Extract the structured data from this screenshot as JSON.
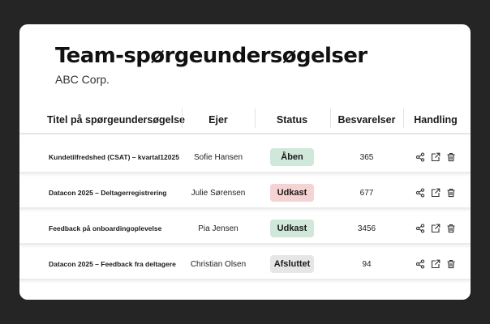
{
  "header": {
    "title": "Team-spørgeundersøgelser",
    "subtitle": "ABC Corp."
  },
  "table": {
    "columns": [
      "Titel på spørgeundersøgelse",
      "Ejer",
      "Status",
      "Besvarelser",
      "Handling"
    ],
    "rows": [
      {
        "title": "Kundetilfredshed (CSAT) – kvartal12025",
        "owner": "Sofie Hansen",
        "status": "Åben",
        "status_color": "#cfe8da",
        "responses": "365"
      },
      {
        "title": "Datacon 2025 – Deltagerregistrering",
        "owner": "Julie Sørensen",
        "status": "Udkast",
        "status_color": "#f6d3d3",
        "responses": "677"
      },
      {
        "title": "Feedback på onboardingoplevelse",
        "owner": "Pia Jensen",
        "status": "Udkast",
        "status_color": "#cfe8da",
        "responses": "3456"
      },
      {
        "title": "Datacon 2025 – Feedback fra deltagere",
        "owner": "Christian Olsen",
        "status": "Afsluttet",
        "status_color": "#e6e6e6",
        "responses": "94"
      }
    ],
    "action_icons": [
      "share-icon",
      "export-icon",
      "trash-icon"
    ]
  },
  "colors": {
    "frame": "#252525",
    "card": "#ffffff"
  }
}
